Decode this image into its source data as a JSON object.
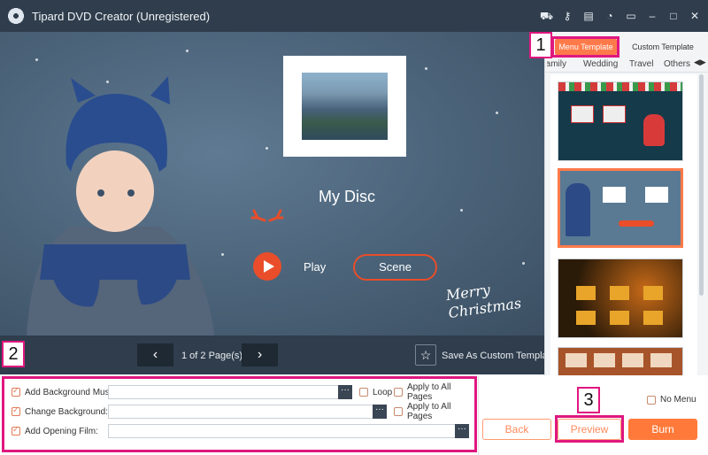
{
  "app": {
    "title": "Tipard DVD Creator (Unregistered)"
  },
  "titlebar_icons": [
    "cart-icon",
    "key-icon",
    "document-icon",
    "chat-icon",
    "feedback-icon",
    "minimize-icon",
    "maximize-icon",
    "close-icon"
  ],
  "preview": {
    "disc_title": "My Disc",
    "play_label": "Play",
    "scene_label": "Scene",
    "decoration_text": "Merry Christmas"
  },
  "pager": {
    "indicator": "1 of 2 Page(s)",
    "save_custom_label": "Save As Custom Template"
  },
  "right_panel": {
    "tabs": [
      "Menu Template",
      "Custom Template"
    ],
    "active_tab": "Menu Template",
    "categories": [
      "Family",
      "Wedding",
      "Travel",
      "Others"
    ],
    "templates": [
      {
        "theme": "Christmas (red)"
      },
      {
        "theme": "Winter child",
        "selected": true
      },
      {
        "theme": "Halloween"
      },
      {
        "theme": "Photo frames"
      }
    ]
  },
  "options": {
    "background_music": {
      "label": "Add Background Music:",
      "checked": true,
      "value": "",
      "loop_label": "Loop",
      "apply_label": "Apply to All Pages"
    },
    "background": {
      "label": "Change Background:",
      "checked": true,
      "value": "",
      "apply_label": "Apply to All Pages"
    },
    "opening_film": {
      "label": "Add Opening Film:",
      "checked": true,
      "value": ""
    }
  },
  "actions": {
    "no_menu_label": "No Menu",
    "back_label": "Back",
    "preview_label": "Preview",
    "burn_label": "Burn"
  },
  "annotations": [
    "1",
    "2",
    "3"
  ],
  "colors": {
    "accent": "#ff7a3a",
    "highlight": "#e0177f",
    "titlebar": "#2f3d4c"
  }
}
